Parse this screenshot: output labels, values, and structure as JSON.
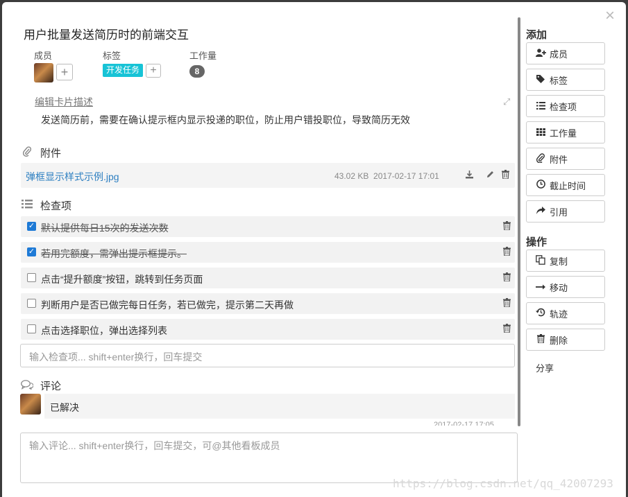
{
  "card": {
    "title": "用户批量发送简历时的前端交互",
    "close_label": "×"
  },
  "meta": {
    "members_label": "成员",
    "tags_label": "标签",
    "workload_label": "工作量",
    "tag": "开发任务",
    "workload_value": "8",
    "add_label": "+"
  },
  "description": {
    "edit_link": "编辑卡片描述",
    "text": "发送简历前，需要在确认提示框内显示投递的职位，防止用户错投职位，导致简历无效",
    "expand_icon": "expand-icon"
  },
  "attachments": {
    "heading": "附件",
    "items": [
      {
        "name": "弹框显示样式示例.jpg",
        "size": "43.02 KB",
        "date": "2017-02-17 17:01"
      }
    ]
  },
  "checklist": {
    "heading": "检查项",
    "items": [
      {
        "text": "默认提供每日15次的发送次数",
        "checked": true
      },
      {
        "text": "若用完额度，需弹出提示框提示。",
        "checked": true
      },
      {
        "text": "点击“提升额度”按钮，跳转到任务页面",
        "checked": false
      },
      {
        "text": "判断用户是否已做完每日任务，若已做完，提示第二天再做",
        "checked": false
      },
      {
        "text": "点击选择职位，弹出选择列表",
        "checked": false
      }
    ],
    "input_placeholder": "输入检查项... shift+enter换行，回车提交"
  },
  "comments": {
    "heading": "评论",
    "items": [
      {
        "text": "已解决",
        "time": "2017-02-17 17:05"
      }
    ],
    "input_placeholder": "输入评论... shift+enter换行，回车提交，可@其他看板成员"
  },
  "sidebar": {
    "add_heading": "添加",
    "add_buttons": [
      {
        "label": "成员",
        "icon": "add-user-icon"
      },
      {
        "label": "标签",
        "icon": "tag-icon"
      },
      {
        "label": "检查项",
        "icon": "list-icon"
      },
      {
        "label": "工作量",
        "icon": "grid-icon"
      },
      {
        "label": "附件",
        "icon": "paperclip-icon"
      },
      {
        "label": "截止时间",
        "icon": "clock-icon"
      },
      {
        "label": "引用",
        "icon": "share-arrow-icon"
      }
    ],
    "ops_heading": "操作",
    "op_buttons": [
      {
        "label": "复制",
        "icon": "copy-icon"
      },
      {
        "label": "移动",
        "icon": "arrow-right-icon"
      },
      {
        "label": "轨迹",
        "icon": "history-icon"
      },
      {
        "label": "删除",
        "icon": "trash-icon"
      }
    ],
    "share_label": "分享"
  },
  "watermark": "https://blog.csdn.net/qq_42007293"
}
